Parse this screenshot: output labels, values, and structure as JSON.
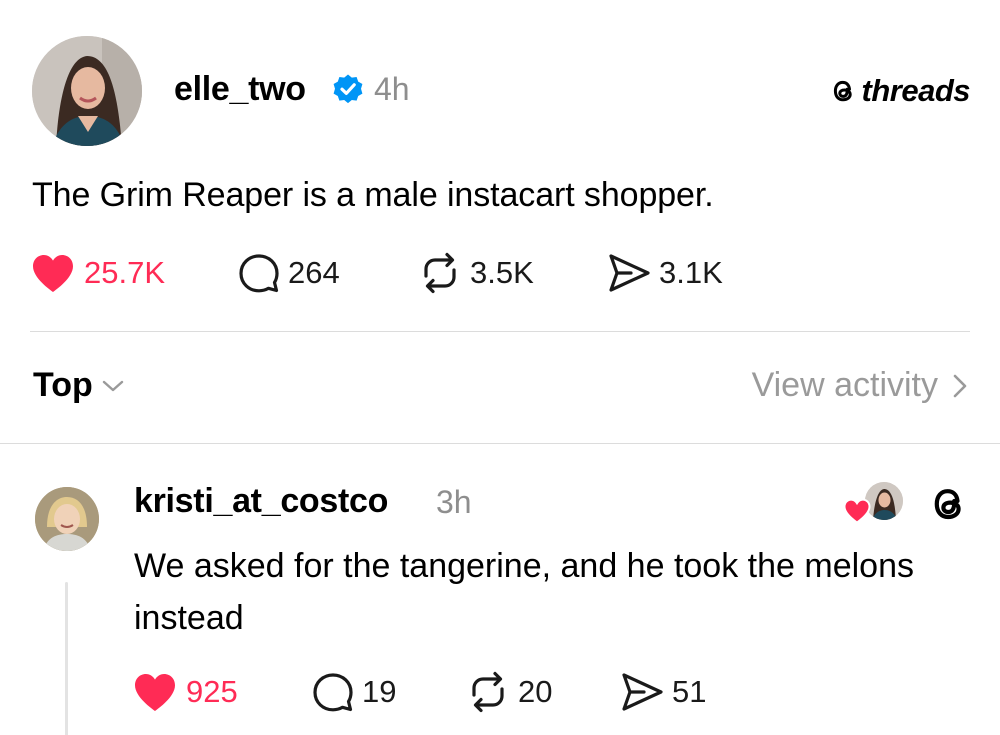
{
  "post": {
    "username": "elle_two",
    "time": "4h",
    "brand": "threads",
    "text": "The Grim Reaper is a male instacart shopper.",
    "likes": "25.7K",
    "replies": "264",
    "reposts": "3.5K",
    "shares": "3.1K",
    "liked": true
  },
  "sort": {
    "label": "Top",
    "activity_label": "View activity"
  },
  "reply": {
    "username": "kristi_at_costco",
    "time": "3h",
    "text": "We asked for the tangerine, and he took the melons instead",
    "likes": "925",
    "replies": "19",
    "reposts": "20",
    "shares": "51",
    "liked": true
  },
  "colors": {
    "like": "#ff2b55",
    "verified": "#0095f6",
    "muted": "#8e8e8e",
    "divider": "#dcdcdc"
  },
  "icons": [
    "verified-badge-icon",
    "threads-logo-icon",
    "heart-icon",
    "comment-icon",
    "repost-icon",
    "share-icon",
    "chevron-down-icon",
    "chevron-right-icon"
  ]
}
